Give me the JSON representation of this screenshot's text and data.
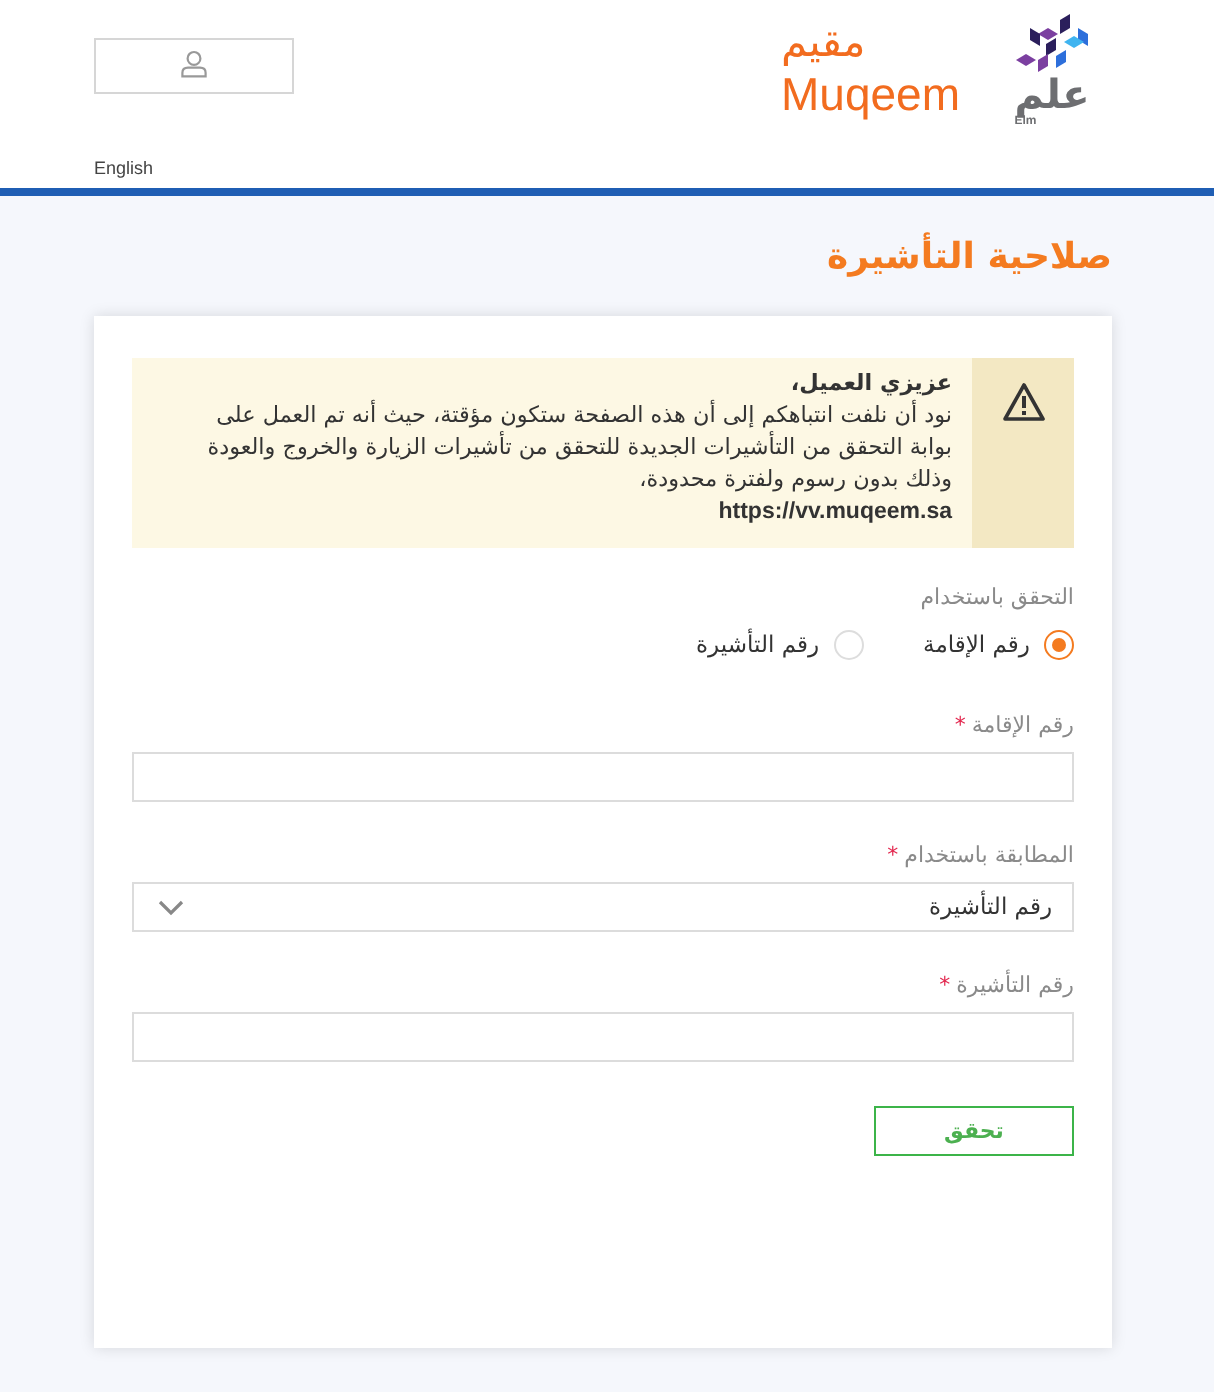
{
  "header": {
    "language_link": "English",
    "muqeem_logo": {
      "arabic": "مقيم",
      "latin": "Muqeem"
    },
    "elm_logo": {
      "arabic": "علم",
      "latin": "Elm"
    }
  },
  "page_title": "صلاحية التأشيرة",
  "notice": {
    "heading": "عزيزي العميل،",
    "body": "نود أن نلفت انتباهكم إلى أن هذه الصفحة ستكون مؤقتة، حيث أنه تم العمل على بوابة التحقق من التأشيرات الجديدة للتحقق من تأشيرات الزيارة والخروج والعودة وذلك بدون رسوم ولفترة محدودة،",
    "link": "https://vv.muqeem.sa"
  },
  "verify_by": {
    "label": "التحقق باستخدام",
    "options": [
      {
        "label": "رقم الإقامة",
        "selected": true
      },
      {
        "label": "رقم التأشيرة",
        "selected": false
      }
    ]
  },
  "fields": [
    {
      "kind": "text",
      "label": "رقم الإقامة",
      "required_mark": "*"
    },
    {
      "kind": "select",
      "label": "المطابقة باستخدام",
      "required_mark": "*",
      "value": "رقم التأشيرة"
    },
    {
      "kind": "text",
      "label": "رقم التأشيرة",
      "required_mark": "*"
    }
  ],
  "submit_button": {
    "label": "تحقق"
  }
}
